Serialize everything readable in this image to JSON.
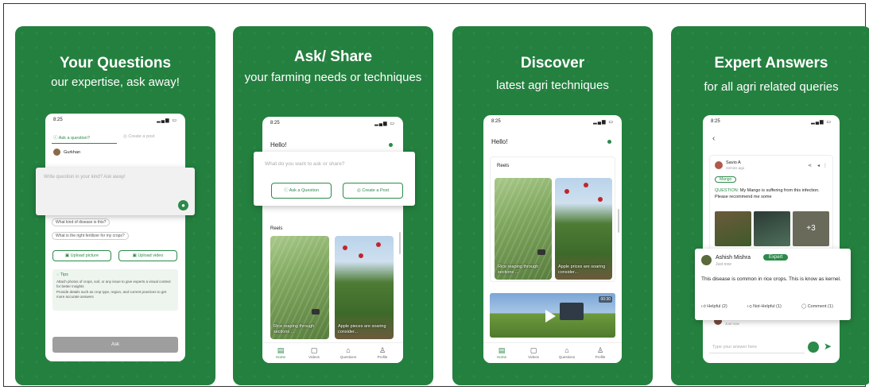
{
  "cards": [
    {
      "title": "Your Questions",
      "subtitle": "our expertise, ask away!",
      "phone": {
        "time": "8:25",
        "tab_ask": "Ask a question?",
        "tab_post": "Create a post",
        "user_name": "Gurkhan",
        "input_placeholder": "Write question in your kind? Ask away!",
        "suggestions": [
          "What kind of disease is this?",
          "What is the right fertilizer for my crops?"
        ],
        "upload_picture": "Upload picture",
        "upload_video": "Upload video",
        "tips_heading": "Tips",
        "tips": [
          "Attach photos of crops, soil, or any issue to give experts a visual context for better insights",
          "Provide details such as crop type, region, and current practices to get more accurate answers"
        ],
        "ask_button": "Ask"
      }
    },
    {
      "title": "Ask/ Share",
      "subtitle": "your farming needs or techniques",
      "phone": {
        "time": "8:25",
        "greeting": "Hello!",
        "prompt_placeholder": "What do you want to ask or share?",
        "ask_question": "Ask a Question",
        "create_post": "Create a Post",
        "reels_label": "Reels",
        "reels": [
          "Rice reaping through sections ...",
          "Apple pieces are soaring consider..."
        ],
        "nav": [
          "Home",
          "Videos",
          "Questions",
          "Profile"
        ]
      }
    },
    {
      "title": "Discover",
      "subtitle": "latest agri techniques",
      "phone": {
        "time": "8:25",
        "greeting": "Hello!",
        "reels_label": "Reels",
        "reels": [
          "Rice reaping through sections ...",
          "Apple prices are soaring consider..."
        ],
        "video_duration": "00:30",
        "nav": [
          "Home",
          "Videos",
          "Questions",
          "Profile"
        ]
      }
    },
    {
      "title": "Expert Answers",
      "subtitle": "for all agri related queries",
      "phone": {
        "time": "8:25",
        "poster_name": "Savio A",
        "poster_time": "42mins ago",
        "tag": "Mango",
        "question_label": "QUESTION:",
        "question_text": "My Mango is suffering from this infection. Please recommend me some",
        "more_images": "+3",
        "expert_name": "Ashish Mishra",
        "expert_badge": "Expert",
        "expert_time": "Just now",
        "answer": "This disease is common in rice crops. This is know as kernel.",
        "helpful": "Helpful (2)",
        "not_helpful": "Not-Helpful (1)",
        "comment": "Comment (1)",
        "reply_name": "Mayuri Smith",
        "reply_time": "Just now",
        "answer_placeholder": "Type your answer here"
      }
    }
  ],
  "colors": {
    "brand_green": "#24803f",
    "accent": "#2c8a4a"
  }
}
